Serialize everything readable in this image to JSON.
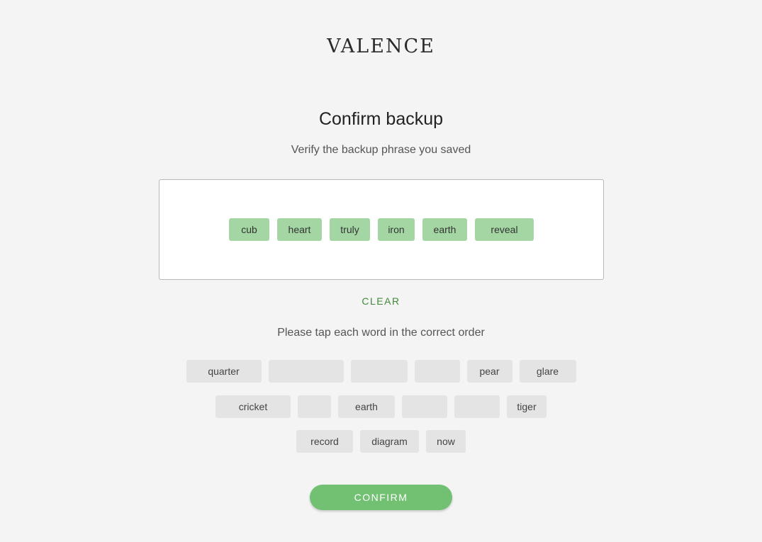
{
  "app": {
    "logo_text": "VALENCE"
  },
  "header": {
    "title": "Confirm backup",
    "subtitle": "Verify the backup phrase you saved"
  },
  "selected_words": [
    "cub",
    "heart",
    "truly",
    "iron",
    "earth",
    "reveal"
  ],
  "clear_label": "CLEAR",
  "instruction": "Please tap each word in the correct order",
  "word_pool": {
    "row1": [
      "quarter",
      "",
      "",
      "",
      "pear",
      "glare"
    ],
    "row2": [
      "cricket",
      "",
      "earth",
      "",
      "",
      "tiger"
    ],
    "row3": [
      "record",
      "diagram",
      "now"
    ]
  },
  "confirm_label": "CONFIRM",
  "colors": {
    "background": "#f4f4f4",
    "selected_chip": "#a3d6a3",
    "pool_chip": "#e4e4e4",
    "accent_green": "#3f8a3a",
    "confirm_button": "#72c072"
  }
}
